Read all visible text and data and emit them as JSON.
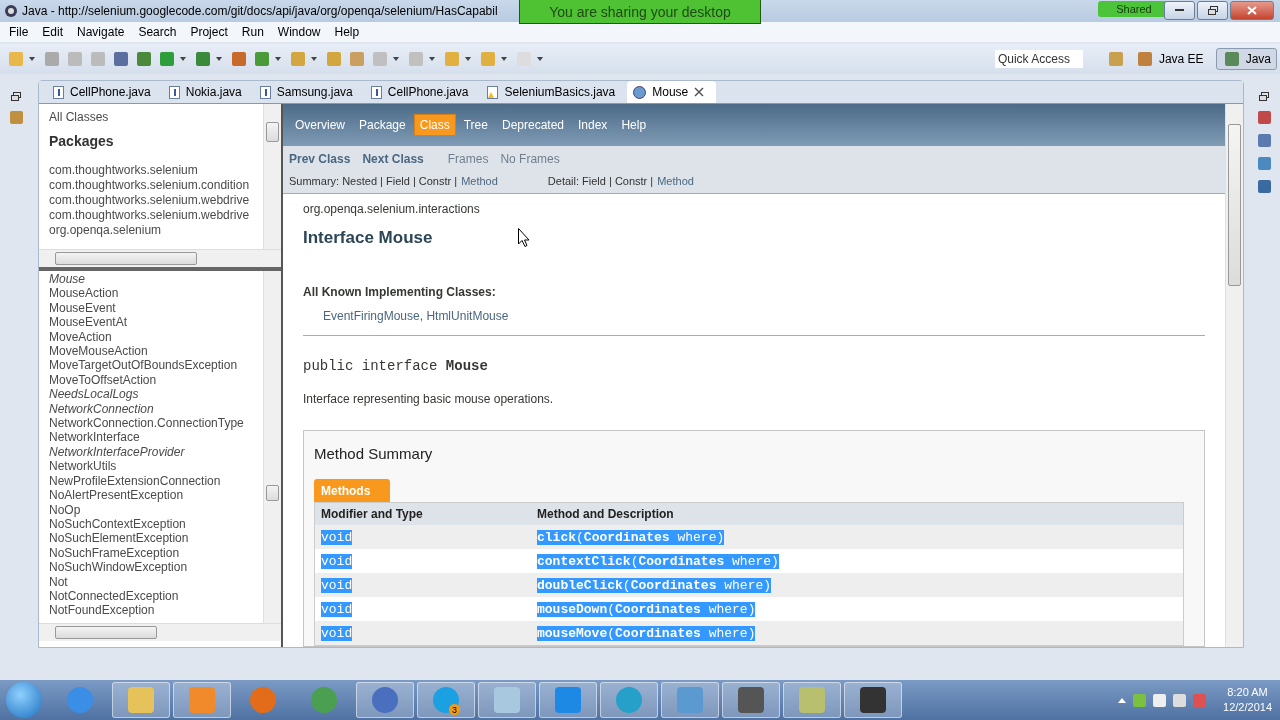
{
  "window": {
    "title": "Java - http://selenium.googlecode.com/git/docs/api/java/org/openqa/selenium/HasCapabil"
  },
  "sharing_banner": "You are sharing your desktop",
  "shared_badge": "Shared",
  "menu": [
    "File",
    "Edit",
    "Navigate",
    "Search",
    "Project",
    "Run",
    "Window",
    "Help"
  ],
  "quick_access": {
    "placeholder": "Quick Access"
  },
  "perspectives": [
    {
      "label": "Java EE",
      "selected": false
    },
    {
      "label": "Java",
      "selected": true
    }
  ],
  "editor_tabs": [
    {
      "label": "CellPhone.java",
      "kind": "java",
      "selected": false
    },
    {
      "label": "Nokia.java",
      "kind": "java",
      "selected": false
    },
    {
      "label": "Samsung.java",
      "kind": "java",
      "selected": false
    },
    {
      "label": "CellPhone.java",
      "kind": "java",
      "selected": false
    },
    {
      "label": "SeleniumBasics.java",
      "kind": "warning",
      "selected": false
    },
    {
      "label": "Mouse",
      "kind": "web",
      "selected": true
    }
  ],
  "packages_pane": {
    "all_classes": "All Classes",
    "heading": "Packages",
    "items": [
      "com.thoughtworks.selenium",
      "com.thoughtworks.selenium.condition",
      "com.thoughtworks.selenium.webdrive",
      "com.thoughtworks.selenium.webdrive",
      "org.openqa.selenium"
    ]
  },
  "classes": [
    {
      "name": "Mouse",
      "italic": true
    },
    {
      "name": "MouseAction",
      "italic": false
    },
    {
      "name": "MouseEvent",
      "italic": false
    },
    {
      "name": "MouseEventAt",
      "italic": false
    },
    {
      "name": "MoveAction",
      "italic": false
    },
    {
      "name": "MoveMouseAction",
      "italic": false
    },
    {
      "name": "MoveTargetOutOfBoundsException",
      "italic": false
    },
    {
      "name": "MoveToOffsetAction",
      "italic": false
    },
    {
      "name": "NeedsLocalLogs",
      "italic": true
    },
    {
      "name": "NetworkConnection",
      "italic": true
    },
    {
      "name": "NetworkConnection.ConnectionType",
      "italic": false
    },
    {
      "name": "NetworkInterface",
      "italic": false
    },
    {
      "name": "NetworkInterfaceProvider",
      "italic": true
    },
    {
      "name": "NetworkUtils",
      "italic": false
    },
    {
      "name": "NewProfileExtensionConnection",
      "italic": false
    },
    {
      "name": "NoAlertPresentException",
      "italic": false
    },
    {
      "name": "NoOp",
      "italic": false
    },
    {
      "name": "NoSuchContextException",
      "italic": false
    },
    {
      "name": "NoSuchElementException",
      "italic": false
    },
    {
      "name": "NoSuchFrameException",
      "italic": false
    },
    {
      "name": "NoSuchWindowException",
      "italic": false
    },
    {
      "name": "Not",
      "italic": false
    },
    {
      "name": "NotConnectedException",
      "italic": false
    },
    {
      "name": "NotFoundException",
      "italic": false
    }
  ],
  "javadoc": {
    "nav": [
      {
        "label": "Overview",
        "selected": false
      },
      {
        "label": "Package",
        "selected": false
      },
      {
        "label": "Class",
        "selected": true
      },
      {
        "label": "Tree",
        "selected": false
      },
      {
        "label": "Deprecated",
        "selected": false
      },
      {
        "label": "Index",
        "selected": false
      },
      {
        "label": "Help",
        "selected": false
      }
    ],
    "prev": "Prev Class",
    "next": "Next Class",
    "frames": "Frames",
    "no_frames": "No Frames",
    "summary": {
      "text": "Summary: Nested | Field | Constr |",
      "link": "Method"
    },
    "detail": {
      "text": "Detail: Field | Constr |",
      "link": "Method"
    },
    "package": "org.openqa.selenium.interactions",
    "title": "Interface Mouse",
    "implementing_heading": "All Known Implementing Classes:",
    "implementing": "EventFiringMouse, HtmlUnitMouse",
    "signature": "public interface **Mouse**",
    "description": "Interface representing basic mouse operations.",
    "method_summary": {
      "title": "Method Summary",
      "tab": "Methods",
      "columns": [
        "Modifier and Type",
        "Method and Description"
      ],
      "rows": [
        {
          "type": "void",
          "method": "**click**(**Coordinates** where)",
          "highlighted": true
        },
        {
          "type": "void",
          "method": "**contextClick**(**Coordinates** where)",
          "highlighted": true
        },
        {
          "type": "void",
          "method": "**doubleClick**(**Coordinates** where)",
          "highlighted": true
        },
        {
          "type": "void",
          "method": "**mouseDown**(**Coordinates** where)",
          "highlighted": true
        },
        {
          "type": "void",
          "method": "**mouseMove**(**Coordinates** where)",
          "highlighted": true
        }
      ]
    }
  },
  "taskbar": {
    "skype_badge": "3",
    "time": "8:20 AM",
    "date": "12/2/2014"
  }
}
